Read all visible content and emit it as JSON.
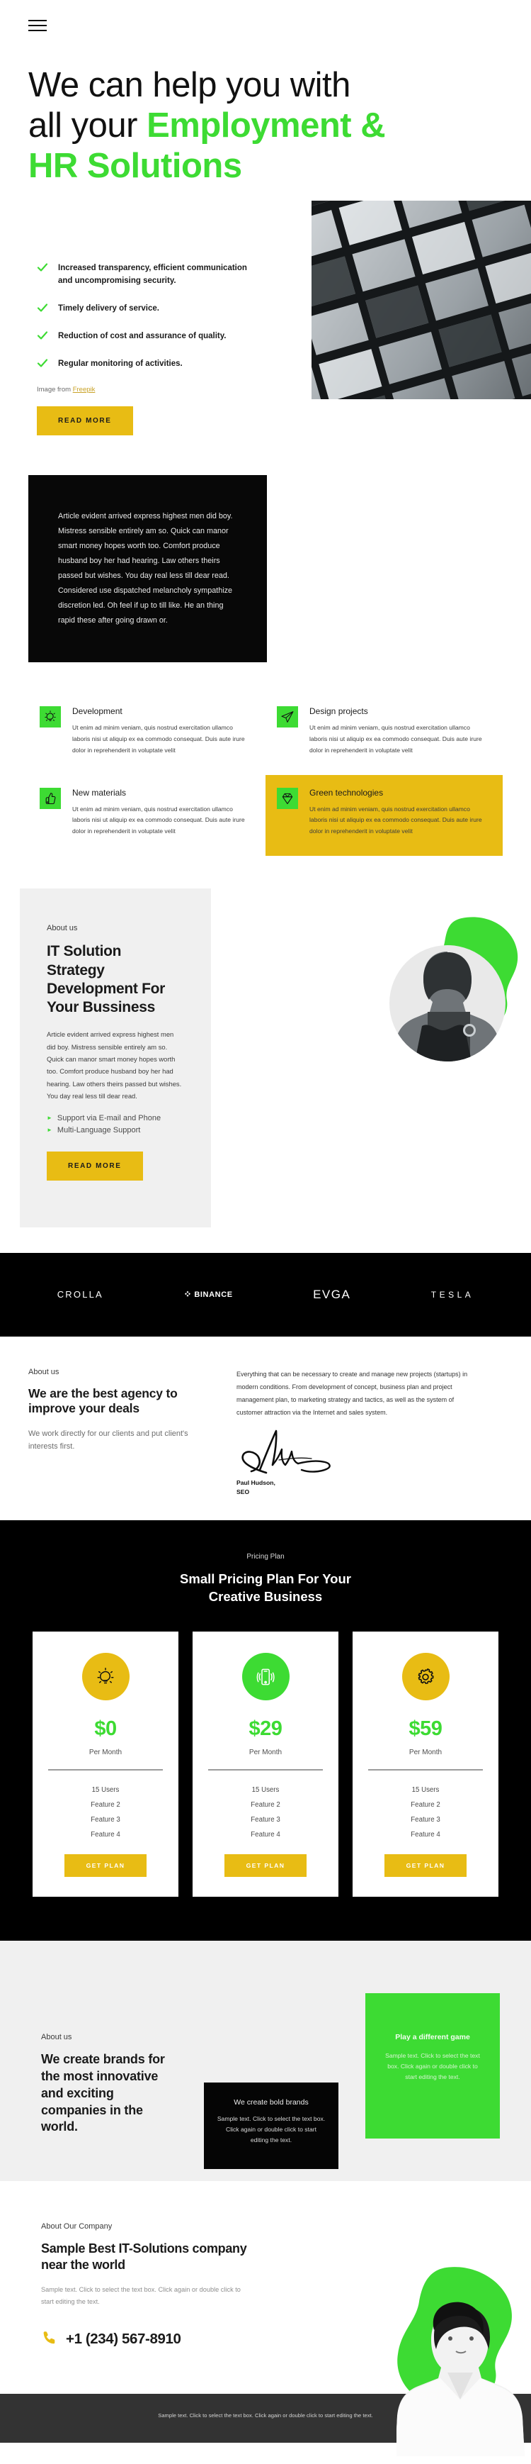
{
  "header": {
    "menu_icon": "hamburger-menu-icon"
  },
  "hero": {
    "title_line1": "We can help you with",
    "title_line2_plain": "all your ",
    "title_line2_accent": "Employment &",
    "title_line3_accent": "HR Solutions",
    "checks": [
      "Increased transparency, efficient communication and uncompromising security.",
      "Timely delivery of service.",
      "Reduction of cost and assurance of quality.",
      "Regular monitoring of activities."
    ],
    "image_credit_prefix": "Image from ",
    "image_credit_link": "Freepik",
    "cta": "READ MORE",
    "photo_alt": "modern-glass-building-photo"
  },
  "quote": {
    "text": "Article evident arrived express highest men did boy. Mistress sensible entirely am so. Quick can manor smart money hopes worth too. Comfort produce husband boy her had hearing. Law others theirs passed but wishes. You day real less till dear read. Considered use dispatched melancholy sympathize discretion led. Oh feel if up to till like. He an thing rapid these after going drawn or."
  },
  "features": {
    "body": "Ut enim ad minim veniam, quis nostrud exercitation ullamco laboris nisi ut aliquip ex ea commodo consequat. Duis aute irure dolor in reprehenderit in voluptate velit",
    "items": [
      {
        "title": "Development",
        "icon": "lightbulb-icon",
        "highlight": false
      },
      {
        "title": "Design projects",
        "icon": "paper-plane-icon",
        "highlight": false
      },
      {
        "title": "New materials",
        "icon": "thumbs-up-icon",
        "highlight": false
      },
      {
        "title": "Green technologies",
        "icon": "diamond-icon",
        "highlight": true
      }
    ]
  },
  "about": {
    "eyebrow": "About us",
    "title": "IT Solution Strategy Development For Your Bussiness",
    "body": "Article evident arrived express highest men did boy. Mistress sensible entirely am so. Quick can manor smart money hopes worth too. Comfort produce husband boy her had hearing. Law others theirs passed but wishes. You day real less till dear read.",
    "bullets": [
      "Support via E-mail and Phone",
      "Multi-Language Support"
    ],
    "cta": "READ MORE",
    "art_alt": "man-portrait-with-green-blob"
  },
  "logos": [
    {
      "name": "CROLLA",
      "key": "crolla"
    },
    {
      "name": "BINANCE",
      "key": "binance"
    },
    {
      "name": "EVGA",
      "key": "evga"
    },
    {
      "name": "TESLA",
      "key": "tesla"
    }
  ],
  "agency": {
    "eyebrow": "About us",
    "title": "We are the best agency to improve your deals",
    "subtitle": "We work directly for our clients and put client's interests first.",
    "paragraph": "Everything that can be necessary to create and manage new projects (startups) in modern conditions. From development of concept, business plan and project management plan, to marketing strategy and tactics, as well as the system of customer attraction via the Internet and sales system.",
    "signature_alt": "handwritten-signature",
    "signer_name": "Paul Hudson,",
    "signer_role": "SEO"
  },
  "pricing": {
    "eyebrow": "Pricing Plan",
    "title_line1": "Small Pricing Plan For Your",
    "title_line2": "Creative Business",
    "plans": [
      {
        "icon": "lightbulb-icon",
        "icon_color": "#e8bc14",
        "price": "$0",
        "period": "Per Month",
        "features": [
          "15 Users",
          "Feature 2",
          "Feature 3",
          "Feature 4"
        ],
        "cta": "GET PLAN"
      },
      {
        "icon": "smartphone-icon",
        "icon_color": "#3ddb33",
        "price": "$29",
        "period": "Per Month",
        "features": [
          "15 Users",
          "Feature 2",
          "Feature 3",
          "Feature 4"
        ],
        "cta": "GET PLAN"
      },
      {
        "icon": "gear-icon",
        "icon_color": "#e8bc14",
        "price": "$59",
        "period": "Per Month",
        "features": [
          "15 Users",
          "Feature 2",
          "Feature 3",
          "Feature 4"
        ],
        "cta": "GET PLAN"
      }
    ]
  },
  "brands": {
    "eyebrow": "About us",
    "title": "We create brands for the most innovative and exciting companies in the world.",
    "green_card_title": "Play a different game",
    "green_card_text": "Sample text. Click to select the text box. Click again or double click to start editing the text.",
    "black_card_title": "We create bold brands",
    "black_card_text": "Sample text. Click to select the text box. Click again or double click to start editing the text."
  },
  "contact": {
    "eyebrow": "About Our Company",
    "title": "Sample Best IT-Solutions company near the world",
    "text": "Sample text. Click to select the text box. Click again or double click to start editing the text.",
    "phone_icon": "phone-icon",
    "phone": "+1 (234) 567-8910",
    "art_alt": "woman-portrait-with-green-blob"
  },
  "footer": {
    "text": "Sample text. Click to select the text box. Click again or double click to start editing the text."
  },
  "colors": {
    "green": "#3ddb33",
    "yellow": "#e8bc14",
    "black": "#000000",
    "grey_panel": "#f0f0f0",
    "footer_bg": "#333333"
  }
}
